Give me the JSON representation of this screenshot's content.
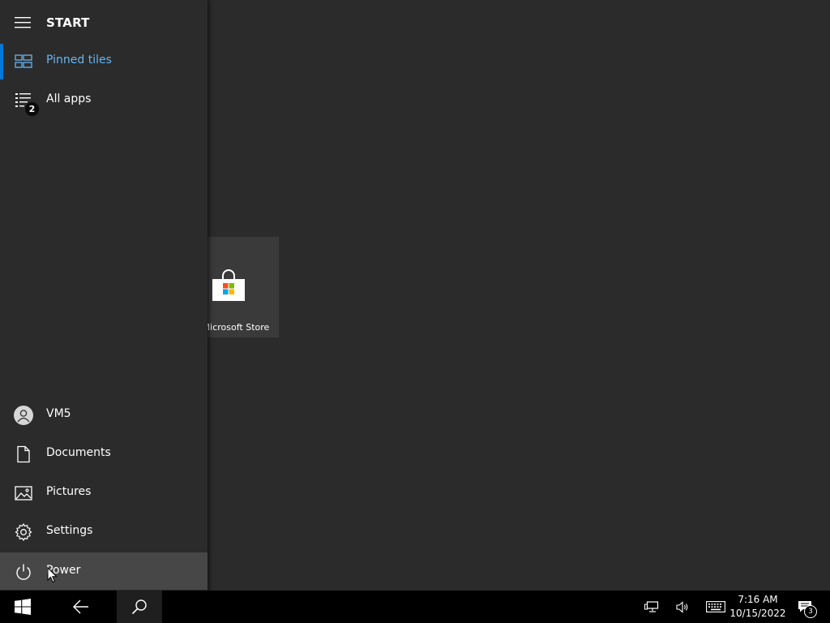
{
  "start_menu": {
    "title": "START",
    "nav_top": [
      {
        "label": "Pinned tiles",
        "icon": "tiles-icon",
        "selected": true
      },
      {
        "label": "All apps",
        "icon": "list-icon",
        "badge": "2"
      }
    ],
    "nav_bottom": [
      {
        "label": "VM5",
        "icon": "user-avatar-icon"
      },
      {
        "label": "Documents",
        "icon": "document-icon"
      },
      {
        "label": "Pictures",
        "icon": "pictures-icon"
      },
      {
        "label": "Settings",
        "icon": "gear-icon"
      },
      {
        "label": "Power",
        "icon": "power-icon",
        "hovered": true
      }
    ]
  },
  "tiles": [
    {
      "label": "Microsoft Store",
      "icon": "store-bag-icon"
    }
  ],
  "taskbar": {
    "buttons": [
      {
        "name": "start",
        "icon": "windows-logo-icon"
      },
      {
        "name": "back",
        "icon": "back-arrow-icon"
      },
      {
        "name": "search",
        "icon": "search-icon"
      }
    ],
    "tray": {
      "icons": [
        "network-icon",
        "volume-icon",
        "keyboard-icon"
      ],
      "time": "7:16 AM",
      "date": "10/15/2022",
      "notification_count": "3"
    }
  },
  "colors": {
    "accent": "#0078d7",
    "selected_text": "#6ab4ee",
    "background": "#2b2b2b",
    "taskbar": "#000000"
  }
}
